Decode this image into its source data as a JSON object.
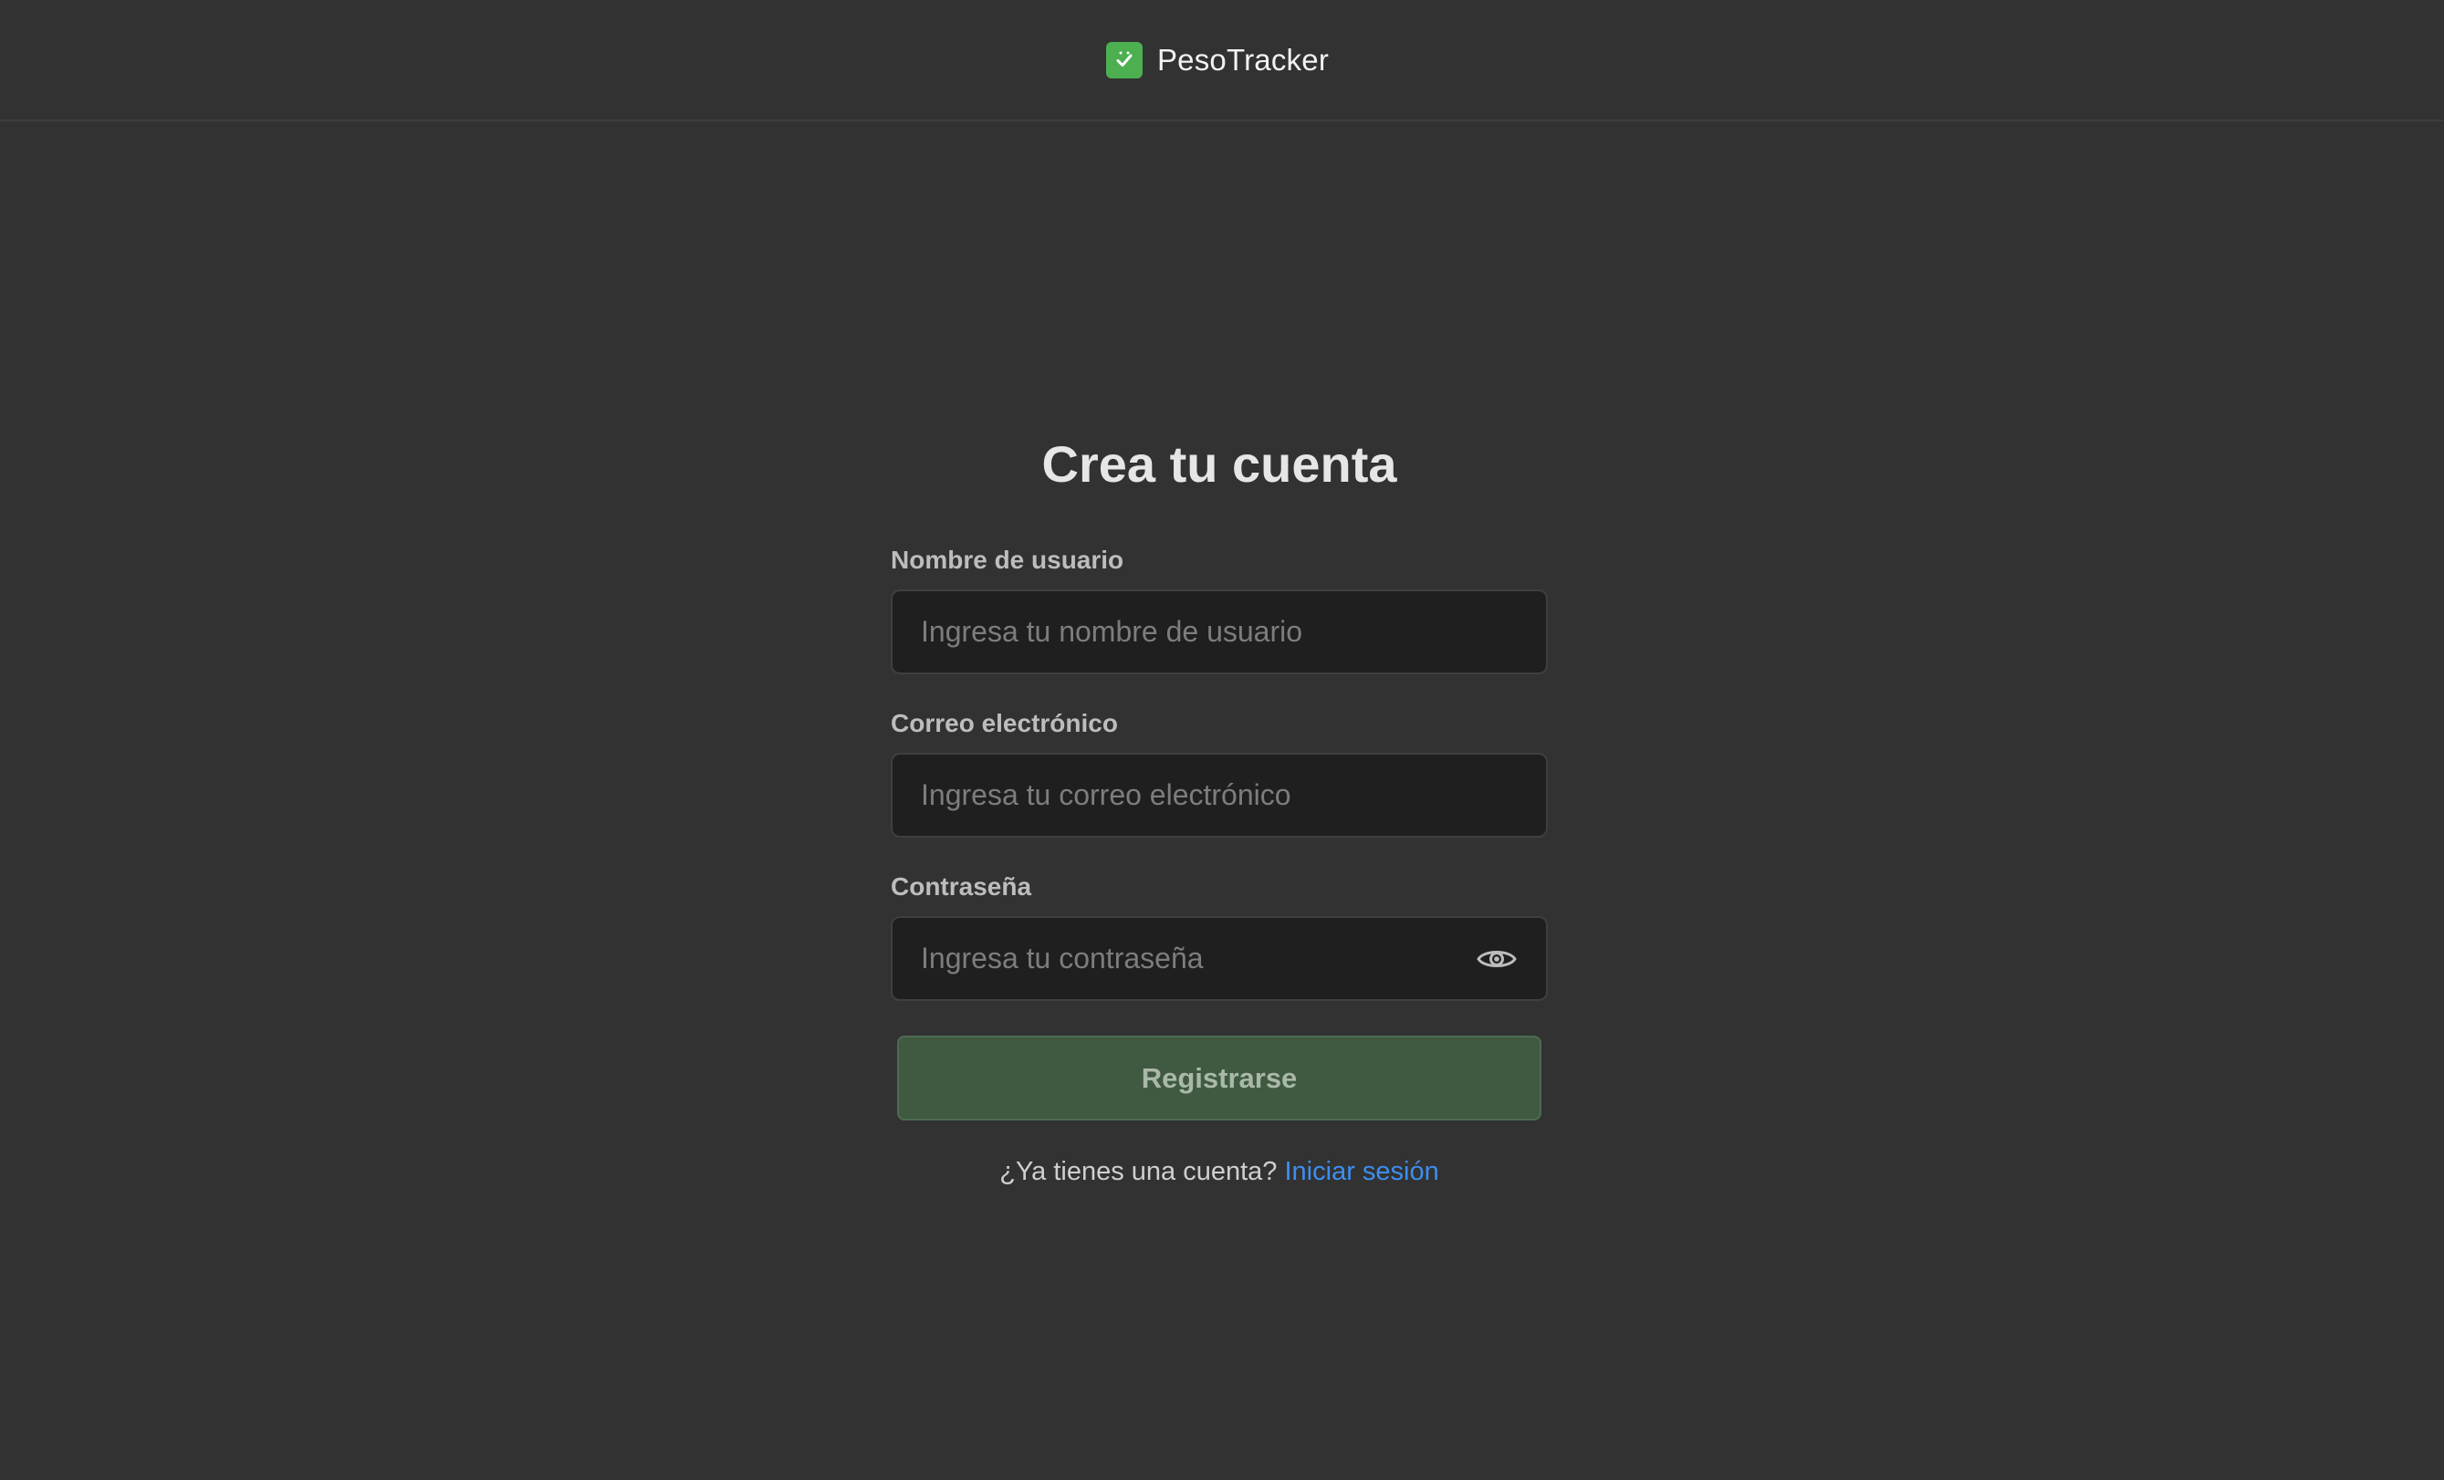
{
  "header": {
    "brand_name": "PesoTracker",
    "logo_icon": "check-icon",
    "logo_color": "#4caf50"
  },
  "form": {
    "title": "Crea tu cuenta",
    "fields": [
      {
        "label": "Nombre de usuario",
        "placeholder": "Ingresa tu nombre de usuario",
        "value": ""
      },
      {
        "label": "Correo electrónico",
        "placeholder": "Ingresa tu correo electrónico",
        "value": ""
      },
      {
        "label": "Contraseña",
        "placeholder": "Ingresa tu contraseña",
        "value": "",
        "toggle_icon": "eye-icon"
      }
    ],
    "submit_label": "Registrarse",
    "submit_color": "#3f5a40",
    "footer_prompt": "¿Ya tienes una cuenta?",
    "footer_link": "Iniciar sesión",
    "link_color": "#3d8ef0"
  }
}
